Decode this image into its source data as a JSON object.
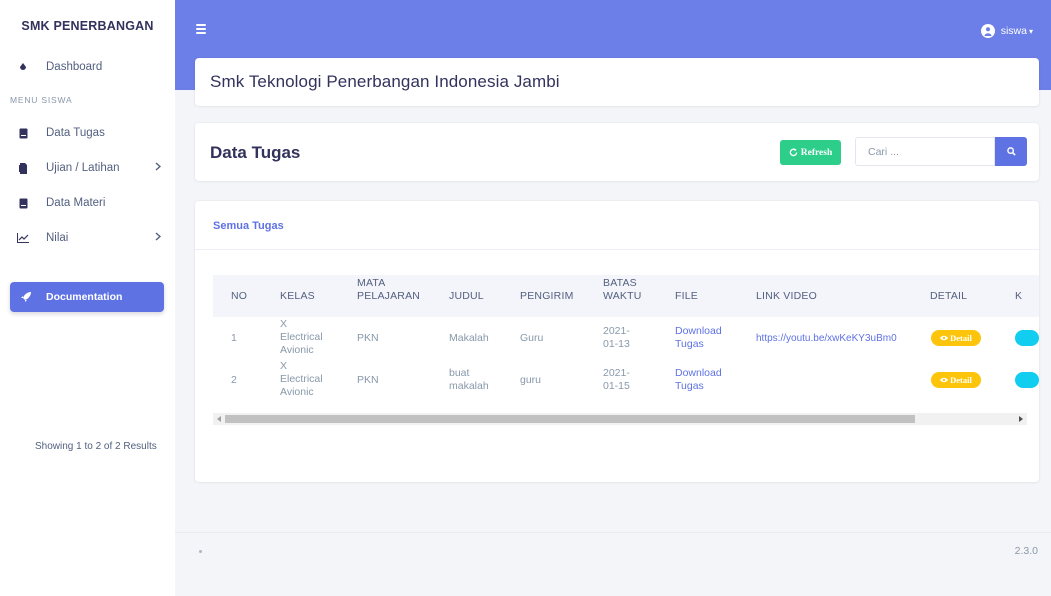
{
  "brand": "SMK PENERBANGAN",
  "sidebar": {
    "dashboard": "Dashboard",
    "heading": "MENU SISWA",
    "items": [
      {
        "label": "Data Tugas",
        "icon": "book-icon"
      },
      {
        "label": "Ujian / Latihan",
        "icon": "file-icon",
        "has_children": true
      },
      {
        "label": "Data Materi",
        "icon": "book-icon"
      },
      {
        "label": "Nilai",
        "icon": "chart-icon",
        "has_children": true
      }
    ],
    "documentation": "Documentation"
  },
  "header": {
    "user_name": "siswa",
    "user_caret": "▾"
  },
  "school_title": "Smk Teknologi Penerbangan Indonesia Jambi",
  "page": {
    "title": "Data Tugas",
    "refresh_label": "Refresh",
    "search_placeholder": "Cari ..."
  },
  "tab": "Semua Tugas",
  "table": {
    "headers": {
      "no": "NO",
      "kelas": "KELAS",
      "mapel_1": "MATA",
      "mapel_2": "PELAJARAN",
      "judul": "JUDUL",
      "pengirim": "PENGIRIM",
      "batas_1": "BATAS",
      "batas_2": "WAKTU",
      "file": "FILE",
      "link": "LINK VIDEO",
      "detail": "DETAIL",
      "next": "K"
    },
    "rows": [
      {
        "no": "1",
        "kelas_1": "X",
        "kelas_2": "Electrical",
        "kelas_3": "Avionic",
        "mapel": "PKN",
        "judul_1": "Makalah",
        "judul_2": "",
        "pengirim": "Guru",
        "batas_1": "2021-",
        "batas_2": "01-13",
        "file_1": "Download",
        "file_2": "Tugas",
        "link": "https://youtu.be/xwKeKY3uBm0",
        "detail": "Detail"
      },
      {
        "no": "2",
        "kelas_1": "X",
        "kelas_2": "Electrical",
        "kelas_3": "Avionic",
        "mapel": "PKN",
        "judul_1": "buat",
        "judul_2": "makalah",
        "pengirim": "guru",
        "batas_1": "2021-",
        "batas_2": "01-15",
        "file_1": "Download",
        "file_2": "Tugas",
        "link": "",
        "detail": "Detail"
      }
    ]
  },
  "showing": "Showing 1 to 2 of 2 Results",
  "footer": {
    "version": "2.3.0"
  },
  "colors": {
    "primary": "#5e72e4",
    "header": "#6c7ee8",
    "success": "#2dce89",
    "warning": "#fcc50b",
    "info": "#11cdef"
  }
}
